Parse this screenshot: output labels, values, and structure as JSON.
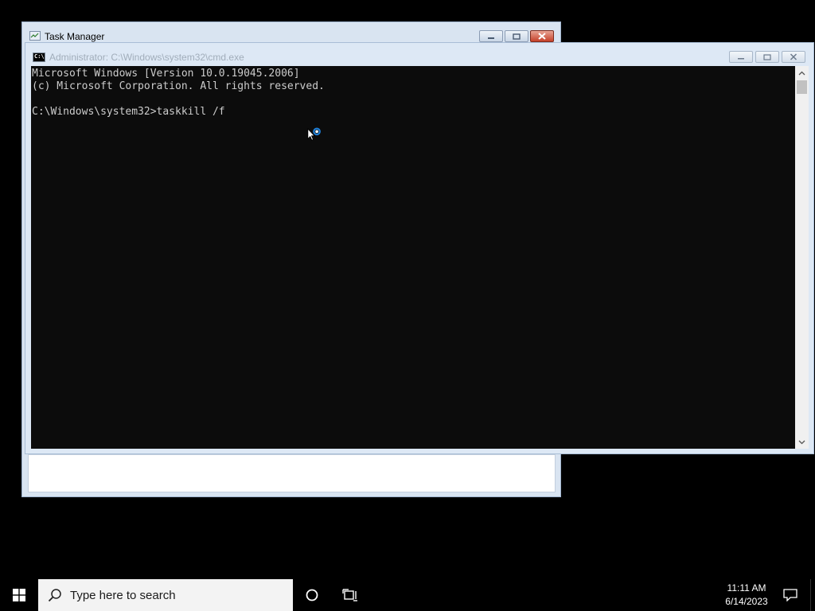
{
  "task_manager": {
    "title": "Task Manager"
  },
  "cmd": {
    "title": "Administrator: C:\\Windows\\system32\\cmd.exe",
    "icon_label": "C:\\",
    "lines": [
      "Microsoft Windows [Version 10.0.19045.2006]",
      "(c) Microsoft Corporation. All rights reserved.",
      "",
      "C:\\Windows\\system32>taskkill /f"
    ]
  },
  "taskbar": {
    "search_placeholder": "Type here to search",
    "time": "11:11 AM",
    "date": "6/14/2023"
  },
  "icons": {
    "start": "windows-logo-icon",
    "search": "search-icon",
    "cortana": "cortana-circle-icon",
    "task_view": "task-view-icon",
    "notifications": "action-center-icon",
    "cursor": "busy-cursor-icon"
  },
  "colors": {
    "console_bg": "#0c0c0c",
    "console_text": "#cccccc",
    "taskbar": "#000000",
    "desktop": "#000000"
  }
}
